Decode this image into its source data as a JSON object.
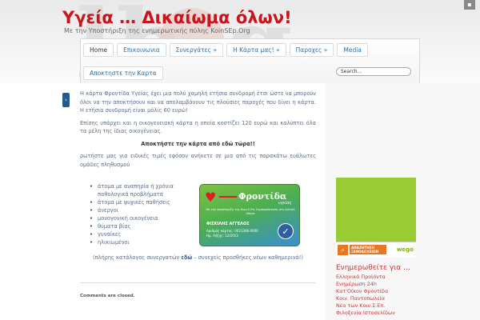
{
  "header": {
    "site_title": "Υγεία … Δικαίωμα όλων!",
    "tagline": "Με την Υποστήριξη της ενημερωτικής πύλης KoinSEp.Org"
  },
  "nav": {
    "row1": [
      {
        "label": "Home",
        "active": true
      },
      {
        "label": "Επικοινωνια"
      },
      {
        "label": "Συνεργάτες »"
      },
      {
        "label": "Η Κάρτα μας! »"
      },
      {
        "label": "Παροχες »"
      },
      {
        "label": "Media"
      }
    ],
    "row2": [
      {
        "label": "Αποκτηστε την Καρτα"
      }
    ],
    "search_placeholder": "Search..."
  },
  "content": {
    "p1": "Η κάρτα Φροντίδα Υγείας έχει μια πολύ χαμηλή ετήσια συνδρομή έτσι ώστε να μπορούν όλοι να την αποκτήσουν και να απολαμβάνουν τις πλούσιες παροχές που δίνει η κάρτα. Η ετήσια συνδρομή είναι μόλις 60 ευρώ!",
    "p2": "Επίσης υπάρχει και η οικογενειακή κάρτα η οποία κοστίζει 120 ευρώ και καλύπτει όλα τα μέλη της ίδιας οικογένειας.",
    "cta": "Αποκτήστε την κάρτα από εδώ τώρα!!",
    "p3": "ρωτήστε μας για ειδικές τιμές εφόσον ανήκετε σε μια από τις παρακάτω ευάλωτες ομάδες πληθυσμού",
    "groups": [
      "άτομα με αναπηρία ή χρόνια παθολογικά προβλήματα",
      "άτομα με ψυχικές παθήσεις",
      "άνεργοι",
      "μονογονική οικογένεια",
      "θύματα βίας",
      "γυναίκες",
      "ηλικιωμένοι"
    ],
    "footer_before": "(πλήρης κατάλογος συνεργατών ",
    "footer_link": "εδώ",
    "footer_after": " – συνεχείς προσθήκες νέων καθημερινά!)",
    "comments": "Comments are closed."
  },
  "card": {
    "brand": "Φροντίδα",
    "brand_sub": "υγείας",
    "fine_print": "Με την υποστήριξη της Κοιν.Σ.Επ. Συμπαράσταση στη Δυτική Αθήνα",
    "holder": "ΦΙΣΚΙΛΗΣ ΑΓΓΕΛΟΣ",
    "number_line": "Αριθμός κάρτας: 0021306-0000",
    "expiry_line": "Ημ. Λήξης: 12/2013"
  },
  "sidebar": {
    "ad_text": "ΑΝΑΖΗΤΗΣΗ ΞΕΝΟΔΟΧΕΙΩΝ",
    "ad_brand": "wego",
    "title": "Ενημερωθείτε για …",
    "links": [
      "Ελληνικά Προϊόντα",
      "Ενημέρωση 24h",
      "Κατ'Οίκον Φροντίδα",
      "Κοιν. Παντοπωλεία",
      "Νέα των Κοιν.Σ.Επ.",
      "Φιλοξενία Ιστοσελίδων"
    ]
  },
  "colors": {
    "title_red": "#c8151b",
    "link_blue": "#2a6ea5",
    "sidebar_red": "#c43a3a"
  }
}
